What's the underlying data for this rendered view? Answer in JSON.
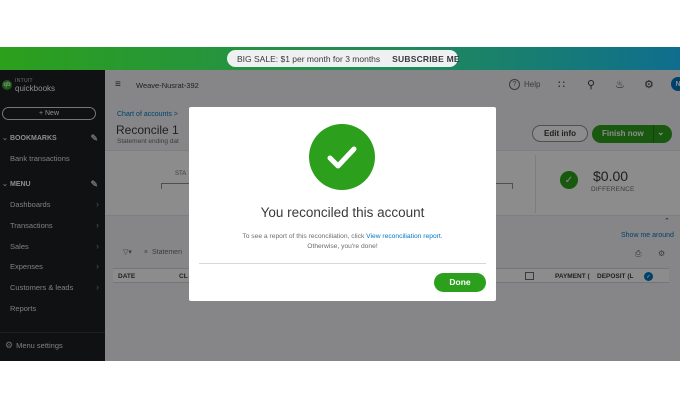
{
  "banner": {
    "promo_text": "BIG SALE: $1 per month for 3 months",
    "cta_label": "SUBSCRIBE ME"
  },
  "sidebar": {
    "logo_brand": "INTUIT",
    "logo_product": "quickbooks",
    "logo_mark": "qb",
    "new_label": "+ New",
    "bookmarks_label": "BOOKMARKS",
    "bookmark_items": [
      "Bank transactions"
    ],
    "menu_label": "MENU",
    "menu_items": [
      "Dashboards",
      "Transactions",
      "Sales",
      "Expenses",
      "Customers & leads",
      "Reports"
    ],
    "menu_settings_label": "Menu settings"
  },
  "topbar": {
    "company_name": "Weave-Nusrat-392",
    "help_label": "Help",
    "avatar_initial": "N"
  },
  "page": {
    "breadcrumb": "Chart of accounts >",
    "title": "Reconcile   1",
    "subtitle": "Statement ending dat",
    "edit_info_label": "Edit info",
    "finish_label": "Finish now",
    "stat_fragment": "STA",
    "difference_amount": "$0.00",
    "difference_label": "DIFFERENCE",
    "show_me_label": "Show me around",
    "filter_label": "Statemen",
    "columns": {
      "date": "DATE",
      "cleared": "CL",
      "payment": "PAYMENT (",
      "deposit": "DEPOSIT (L"
    }
  },
  "modal": {
    "title": "You reconciled this account",
    "body_prefix": "To see a report of this reconciliation, click ",
    "body_link": "View reconciliation report",
    "body_suffix": ".",
    "body_line2": "Otherwise, you're done!",
    "done_label": "Done"
  },
  "colors": {
    "accent_green": "#2ca01c",
    "link_blue": "#0077c5",
    "sidebar_bg": "#1e1f22"
  }
}
